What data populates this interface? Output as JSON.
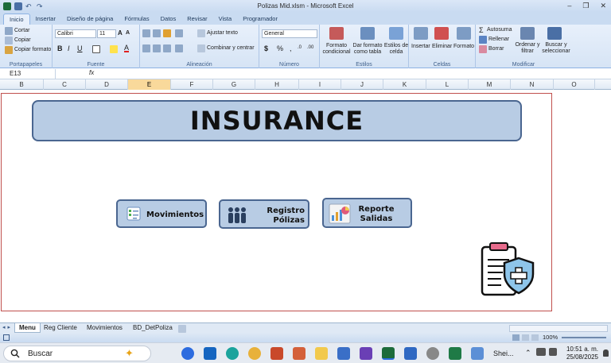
{
  "window": {
    "title": "Polizas Mid.xlsm - Microsoft Excel",
    "min_label": "–",
    "restore_label": "❐",
    "close_label": "✕"
  },
  "ribbon": {
    "tabs": [
      "Inicio",
      "Insertar",
      "Diseño de página",
      "Fórmulas",
      "Datos",
      "Revisar",
      "Vista",
      "Programador"
    ],
    "clipboard": {
      "cut": "Cortar",
      "copy": "Copiar",
      "format_painter": "Copiar formato",
      "label": "Portapapeles"
    },
    "font": {
      "name": "Calibri",
      "size": "11",
      "label": "Fuente"
    },
    "alignment": {
      "wrap": "Ajustar texto",
      "merge": "Combinar y centrar",
      "label": "Alineación"
    },
    "number": {
      "format": "General",
      "label": "Número"
    },
    "styles": {
      "conditional": "Formato condicional",
      "table": "Dar formato como tabla",
      "cell": "Estilos de celda",
      "label": "Estilos"
    },
    "cells": {
      "insert": "Insertar",
      "delete": "Eliminar",
      "format": "Formato",
      "label": "Celdas"
    },
    "editing": {
      "autosum": "Autosuma",
      "fill": "Rellenar",
      "clear": "Borrar",
      "sort": "Ordenar y filtrar",
      "find": "Buscar y seleccionar",
      "label": "Modificar"
    }
  },
  "formula_bar": {
    "name_box": "E13",
    "fx": "fx",
    "value": ""
  },
  "columns": [
    "B",
    "C",
    "D",
    "E",
    "F",
    "G",
    "H",
    "I",
    "J",
    "K",
    "L",
    "M",
    "N",
    "O"
  ],
  "selected_column": "E",
  "sheet": {
    "banner": "INSURANCE",
    "buttons": {
      "movimientos": "Movimientos",
      "registro_1": "Registro",
      "registro_2": "Pólizas",
      "reporte_1": "Reporte",
      "reporte_2": "Salidas"
    }
  },
  "sheet_tabs": [
    "Menu",
    "Reg Cliente",
    "Movimientos",
    "BD_DetPoliza"
  ],
  "active_sheet": "Menu",
  "status": {
    "zoom": "100%"
  },
  "taskbar": {
    "search": "Buscar",
    "app_label": "Shei...",
    "time": "10:51 a. m.",
    "date": "25/08/2025"
  }
}
